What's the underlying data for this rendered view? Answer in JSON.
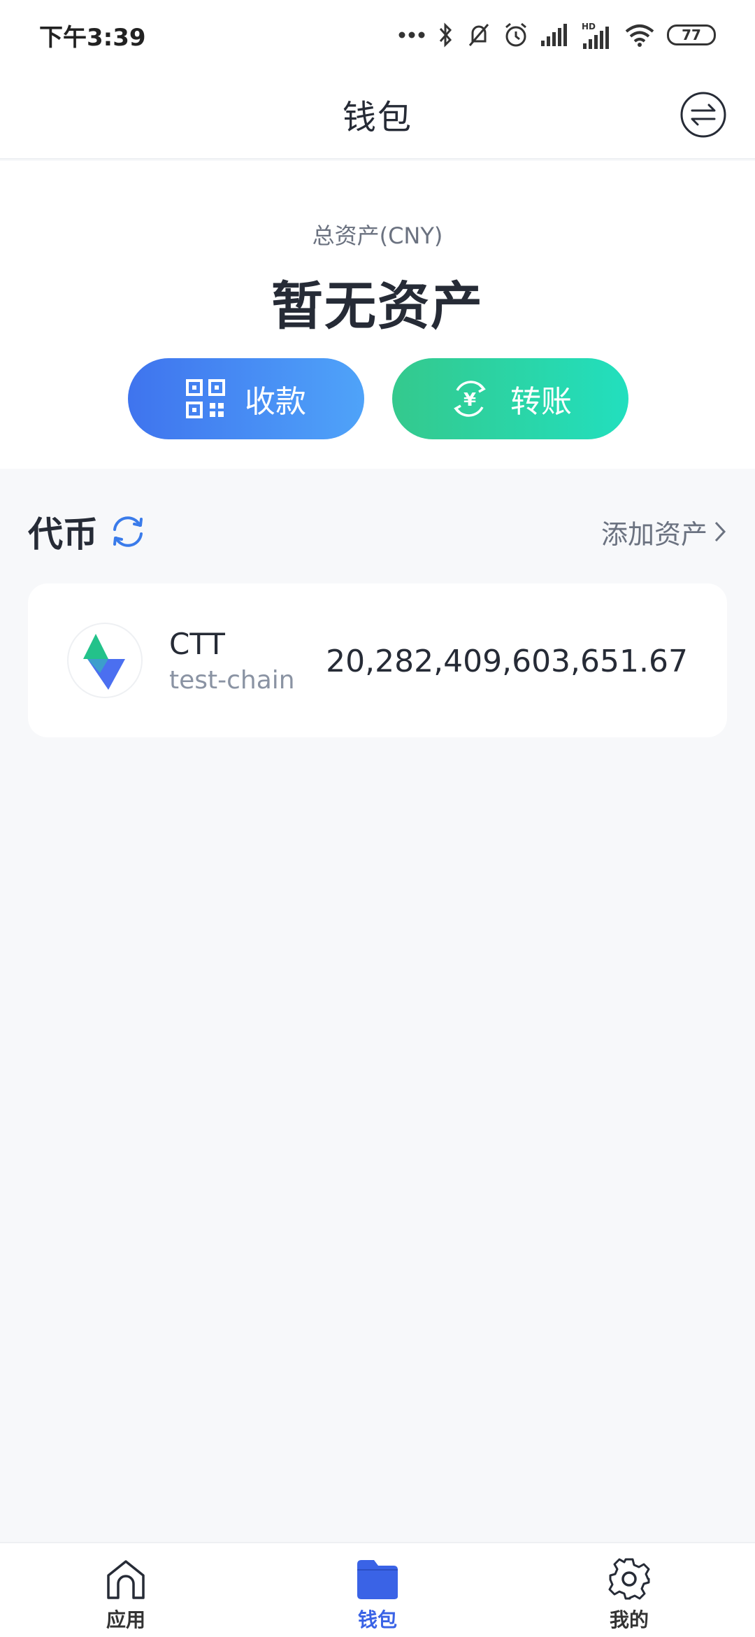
{
  "status_bar": {
    "time": "下午3:39",
    "battery": "77"
  },
  "header": {
    "title": "钱包"
  },
  "asset": {
    "label": "总资产(CNY)",
    "value": "暂无资产"
  },
  "actions": {
    "receive_label": "收款",
    "transfer_label": "转账"
  },
  "tokens": {
    "title": "代币",
    "add_label": "添加资产",
    "items": [
      {
        "symbol": "CTT",
        "chain": "test-chain",
        "amount": "20,282,409,603,651.67"
      }
    ]
  },
  "nav": {
    "items": [
      {
        "label": "应用",
        "icon": "home-icon",
        "active": false
      },
      {
        "label": "钱包",
        "icon": "wallet-icon",
        "active": true
      },
      {
        "label": "我的",
        "icon": "gear-icon",
        "active": false
      }
    ]
  },
  "colors": {
    "accent": "#3a63e6",
    "receive_gradient": [
      "#3f74ee",
      "#4fa3f9"
    ],
    "transfer_gradient": [
      "#34c98d",
      "#22dfbe"
    ],
    "background": "#f7f8fa"
  }
}
